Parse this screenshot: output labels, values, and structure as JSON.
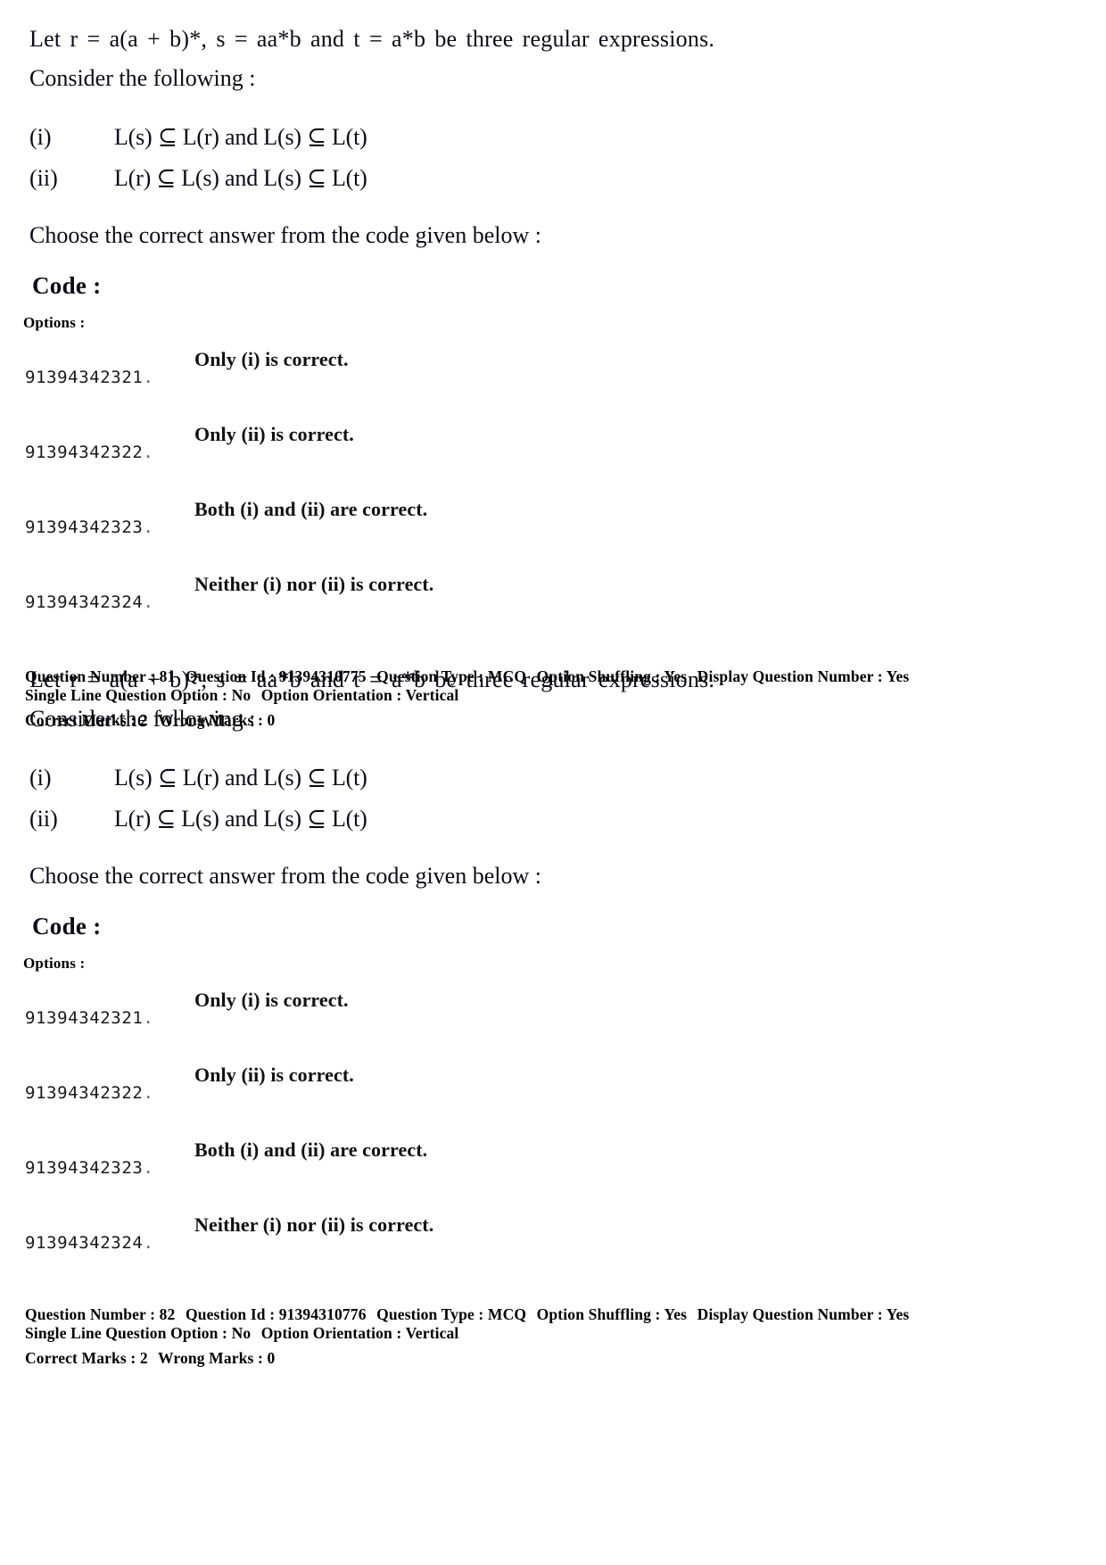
{
  "document": {
    "type": "exam-question-paper",
    "page_background": "#ffffff",
    "text_color": "#0b0b18"
  },
  "questions": [
    {
      "stem": {
        "line1": "Let r = a(a + b)*, s = aa*b and t = a*b be three regular expressions.",
        "line2": "Consider the following :",
        "statements": [
          {
            "label": "(i)",
            "text": "L(s) ⊆ L(r) and L(s) ⊆ L(t)"
          },
          {
            "label": "(ii)",
            "text": "L(r) ⊆ L(s) and L(s) ⊆ L(t)"
          }
        ],
        "line3": "Choose the correct answer from the code given below :",
        "code_heading": "Code :"
      },
      "options_heading": "Options :",
      "options": [
        {
          "id": "91394342321",
          "text": "Only (i) is correct."
        },
        {
          "id": "91394342322",
          "text": "Only (ii) is correct."
        },
        {
          "id": "91394342323",
          "text": "Both (i) and (ii) are correct."
        },
        {
          "id": "91394342324",
          "text": "Neither (i) nor (ii) is correct."
        }
      ]
    },
    {
      "stem": {
        "line1": "Let r = a(a + b)*, s = aa*b and t = a*b be three regular expressions.",
        "line2": "Consider the following :",
        "statements": [
          {
            "label": "(i)",
            "text": "L(s) ⊆ L(r) and L(s) ⊆ L(t)"
          },
          {
            "label": "(ii)",
            "text": "L(r) ⊆ L(s) and L(s) ⊆ L(t)"
          }
        ],
        "line3": "Choose the correct answer from the code given below :",
        "code_heading": "Code :"
      },
      "options_heading": "Options :",
      "options": [
        {
          "id": "91394342321",
          "text": "Only (i) is correct."
        },
        {
          "id": "91394342322",
          "text": "Only (ii) is correct."
        },
        {
          "id": "91394342323",
          "text": "Both (i) and (ii) are correct."
        },
        {
          "id": "91394342324",
          "text": "Neither (i) nor (ii) is correct."
        }
      ]
    }
  ],
  "metadata_blocks": [
    {
      "question_number_label": "Question Number :",
      "question_number": "81",
      "question_id_label": "Question Id :",
      "question_id": "91394310775",
      "question_type_label": "Question Type :",
      "question_type": "MCQ",
      "option_shuffling_label": "Option Shuffling :",
      "option_shuffling": "Yes",
      "display_question_number_label": "Display Question Number :",
      "display_question_number": "Yes",
      "single_line_option_label": "Single Line Question Option :",
      "single_line_option": "No",
      "option_orientation_label": "Option Orientation :",
      "option_orientation": "Vertical",
      "correct_marks_label": "Correct Marks :",
      "correct_marks": "2",
      "wrong_marks_label": "Wrong Marks :",
      "wrong_marks": "0"
    },
    {
      "question_number_label": "Question Number :",
      "question_number": "82",
      "question_id_label": "Question Id :",
      "question_id": "91394310776",
      "question_type_label": "Question Type :",
      "question_type": "MCQ",
      "option_shuffling_label": "Option Shuffling :",
      "option_shuffling": "Yes",
      "display_question_number_label": "Display Question Number :",
      "display_question_number": "Yes",
      "single_line_option_label": "Single Line Question Option :",
      "single_line_option": "No",
      "option_orientation_label": "Option Orientation :",
      "option_orientation": "Vertical",
      "correct_marks_label": "Correct Marks :",
      "correct_marks": "2",
      "wrong_marks_label": "Wrong Marks :",
      "wrong_marks": "0"
    }
  ]
}
